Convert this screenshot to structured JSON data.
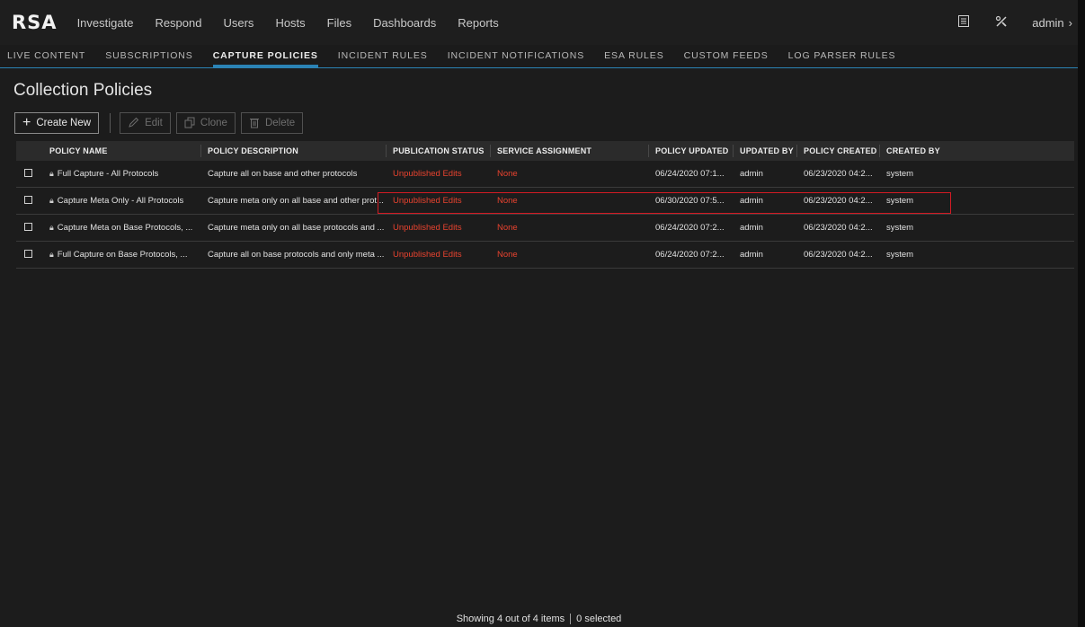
{
  "app": {
    "logo": "RSA",
    "nav": [
      "Investigate",
      "Respond",
      "Users",
      "Hosts",
      "Files",
      "Dashboards",
      "Reports"
    ],
    "user": "admin",
    "icons": [
      "report-icon",
      "tools-icon",
      "chevron-right-icon"
    ]
  },
  "subnav": {
    "items": [
      "LIVE CONTENT",
      "SUBSCRIPTIONS",
      "CAPTURE POLICIES",
      "INCIDENT RULES",
      "INCIDENT NOTIFICATIONS",
      "ESA RULES",
      "CUSTOM FEEDS",
      "LOG PARSER RULES"
    ],
    "active": "CAPTURE POLICIES"
  },
  "page": {
    "title": "Collection Policies"
  },
  "toolbar": {
    "create_new": "Create New",
    "edit": "Edit",
    "clone": "Clone",
    "delete": "Delete"
  },
  "table": {
    "headers": [
      "POLICY NAME",
      "POLICY DESCRIPTION",
      "PUBLICATION STATUS",
      "SERVICE ASSIGNMENT",
      "POLICY UPDATED",
      "UPDATED BY",
      "POLICY CREATED",
      "CREATED BY"
    ],
    "rows": [
      {
        "name": "Full Capture - All Protocols",
        "description": "Capture all on base and other protocols",
        "status": "Unpublished Edits",
        "service": "None",
        "updated": "06/24/2020 07:1...",
        "updated_by": "admin",
        "created": "06/23/2020 04:2...",
        "created_by": "system"
      },
      {
        "name": "Capture Meta Only - All Protocols",
        "description": "Capture meta only on all base and other prot...",
        "status": "Unpublished Edits",
        "service": "None",
        "updated": "06/30/2020 07:5...",
        "updated_by": "admin",
        "created": "06/23/2020 04:2...",
        "created_by": "system"
      },
      {
        "name": "Capture Meta on Base Protocols, ...",
        "description": "Capture meta only on all base protocols and ...",
        "status": "Unpublished Edits",
        "service": "None",
        "updated": "06/24/2020 07:2...",
        "updated_by": "admin",
        "created": "06/23/2020 04:2...",
        "created_by": "system"
      },
      {
        "name": "Full Capture on Base Protocols, ...",
        "description": "Capture all on base protocols and only meta ...",
        "status": "Unpublished Edits",
        "service": "None",
        "updated": "06/24/2020 07:2...",
        "updated_by": "admin",
        "created": "06/23/2020 04:2...",
        "created_by": "system"
      }
    ]
  },
  "footer": {
    "showing": "Showing 4 out of 4 items",
    "selected": "0 selected"
  },
  "colors": {
    "accent": "#2b83b5",
    "status_red": "#e8432f",
    "highlight": "#d21b24"
  }
}
